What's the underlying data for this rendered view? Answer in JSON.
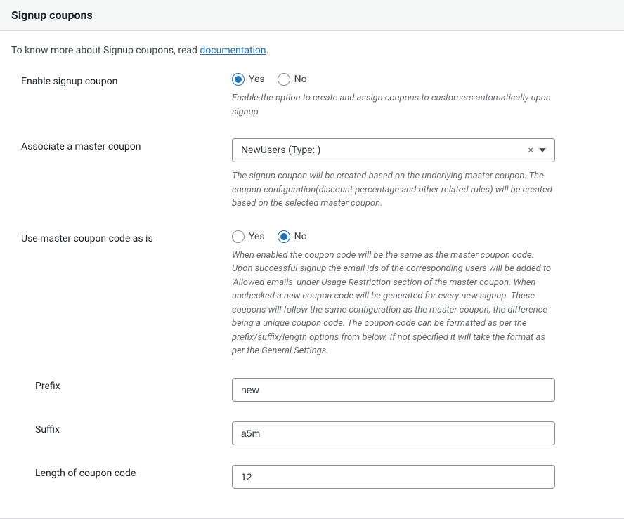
{
  "header": {
    "title": "Signup coupons"
  },
  "intro": {
    "prefix": "To know more about Signup coupons, read ",
    "link": "documentation",
    "suffix": "."
  },
  "fields": {
    "enable": {
      "label": "Enable signup coupon",
      "yes": "Yes",
      "no": "No",
      "selected": "yes",
      "description": "Enable the option to create and assign coupons to customers automatically upon signup"
    },
    "associate": {
      "label": "Associate a master coupon",
      "value": "NewUsers (Type: )",
      "description": "The signup coupon will be created based on the underlying master coupon. The coupon configuration(discount percentage and other related rules) will be created based on the selected master coupon."
    },
    "use_master": {
      "label": "Use master coupon code as is",
      "yes": "Yes",
      "no": "No",
      "selected": "no",
      "description": "When enabled the coupon code will be the same as the master coupon code. Upon successful signup the email ids of the corresponding users will be added to 'Allowed emails' under Usage Restriction section of the master coupon. When unchecked a new coupon code will be generated for every new signup. These coupons will follow the same configuration as the master coupon, the difference being a unique coupon code. The coupon code can be formatted as per the prefix/suffix/length options from below. If not specified it will take the format as per the General Settings."
    },
    "prefix": {
      "label": "Prefix",
      "value": "new"
    },
    "suffix": {
      "label": "Suffix",
      "value": "a5m"
    },
    "length": {
      "label": "Length of coupon code",
      "value": "12"
    }
  }
}
